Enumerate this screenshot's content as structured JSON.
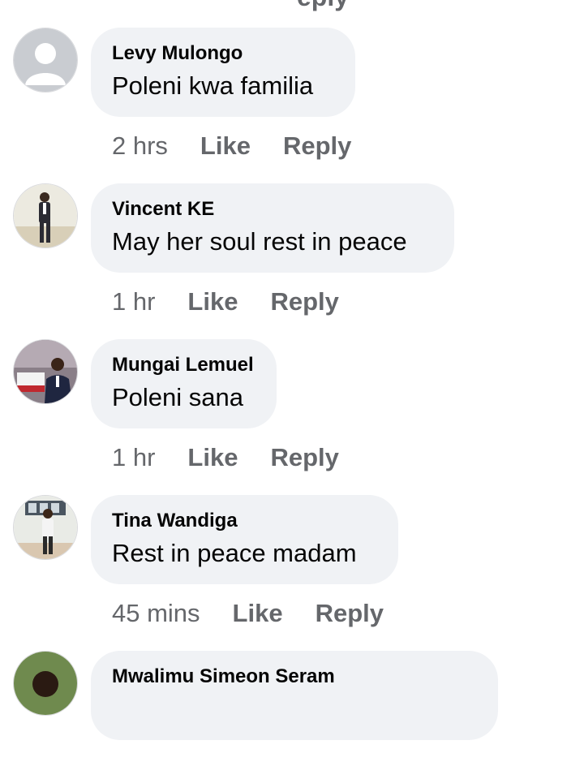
{
  "top_fragment": "eply",
  "comments": [
    {
      "author": "Levy Mulongo",
      "text": "Poleni kwa familia",
      "time": "2 hrs",
      "like_label": "Like",
      "reply_label": "Reply",
      "avatar": "default-avatar"
    },
    {
      "author": "Vincent KE",
      "text": "May her soul rest in peace",
      "time": "1 hr",
      "like_label": "Like",
      "reply_label": "Reply",
      "avatar": "photo-avatar"
    },
    {
      "author": "Mungai Lemuel",
      "text": "Poleni sana",
      "time": "1 hr",
      "like_label": "Like",
      "reply_label": "Reply",
      "avatar": "photo-avatar"
    },
    {
      "author": "Tina Wandiga",
      "text": "Rest in peace madam",
      "time": "45 mins",
      "like_label": "Like",
      "reply_label": "Reply",
      "avatar": "photo-avatar"
    },
    {
      "author": "Mwalimu Simeon Seram",
      "text": "",
      "time": "",
      "like_label": "",
      "reply_label": "",
      "avatar": "photo-avatar"
    }
  ],
  "colors": {
    "bubble_bg": "#f0f2f5",
    "primary_text": "#050505",
    "secondary_text": "#65676b"
  }
}
